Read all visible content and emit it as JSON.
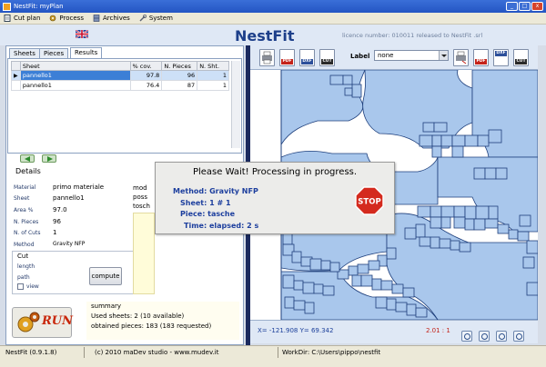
{
  "window": {
    "title": "NestFit: myPlan"
  },
  "menu": [
    {
      "label": "Cut plan",
      "icon": "document-icon"
    },
    {
      "label": "Process",
      "icon": "gear-icon"
    },
    {
      "label": "Archives",
      "icon": "cabinet-icon"
    },
    {
      "label": "System",
      "icon": "wrench-icon"
    }
  ],
  "header": {
    "brand": "NestFit",
    "licence": "licence number: 010011 released to NestFit .srl"
  },
  "tabs": [
    "Sheets",
    "Pieces",
    "Results"
  ],
  "results": {
    "columns": [
      "Sheet",
      "% cov.",
      "N. Pieces",
      "N. Sht."
    ],
    "rows": [
      {
        "sheet": "pannello1",
        "coverage": "97.8",
        "pieces": "96",
        "sheets": "1"
      },
      {
        "sheet": "pannello1",
        "coverage": "76.4",
        "pieces": "87",
        "sheets": "1"
      }
    ]
  },
  "details": {
    "title": "Details",
    "fields": [
      {
        "label": "Material",
        "value": "primo materiale"
      },
      {
        "label": "Sheet",
        "value": "pannello1"
      },
      {
        "label": "Area %",
        "value": "97.0"
      },
      {
        "label": "N. Pieces",
        "value": "96"
      },
      {
        "label": "N. of Cuts",
        "value": "1"
      },
      {
        "label": "Method",
        "value": "Gravity NFP"
      }
    ]
  },
  "cut": {
    "title": "Cut",
    "length_label": "length",
    "path_label": "path",
    "view_label": "view",
    "compute_label": "compute"
  },
  "notes": {
    "line1": "mod",
    "line2": "poss",
    "line3": "tosch"
  },
  "run": {
    "label": "RUN"
  },
  "summary": {
    "title": "summary",
    "sheets": "Used sheets: 2 (10 available)",
    "pieces": "obtained pieces: 183 (183 requested)"
  },
  "toolbar": {
    "icons": [
      {
        "name": "printer-icon",
        "tag": ""
      },
      {
        "name": "pdf-export-icon",
        "tag": "PDF"
      },
      {
        "name": "dxf-export-icon",
        "tag": "DXF"
      },
      {
        "name": "cut-export-icon",
        "tag": "CUT"
      },
      {
        "name": "printer-all-icon",
        "tag": ""
      },
      {
        "name": "pdf-all-icon",
        "tag": "PDF"
      },
      {
        "name": "dxf-all-icon",
        "tag": "DXF"
      },
      {
        "name": "cut-all-icon",
        "tag": "CUT"
      }
    ],
    "label_caption": "Label",
    "label_value": "none"
  },
  "canvas_status": {
    "coords": "X= -121.908   Y= 69.342",
    "scale": "2.01 : 1"
  },
  "dialog": {
    "title": "Please Wait! Processing in progress.",
    "method": "Method: Gravity NFP",
    "sheet": "Sheet: 1 # 1",
    "piece": "Piece: tasche",
    "time": "Time: elapsed: 2 s",
    "stop_label": "STOP"
  },
  "statusbar": {
    "version": "NestFit (0.9.1.8)",
    "copyright": "(c) 2010 maDev studio - www.mudev.it",
    "workdir": "WorkDir: C:\\Users\\pippo\\nestfit"
  },
  "colors": {
    "piece_fill": "#a9c7ec",
    "piece_stroke": "#1e3f7c",
    "accent": "#1d3f8a",
    "run": "#c8260a"
  }
}
